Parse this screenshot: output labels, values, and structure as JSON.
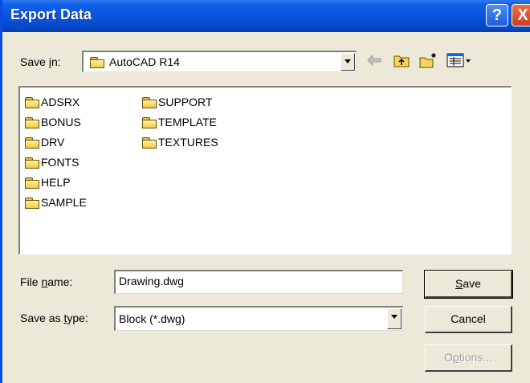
{
  "window": {
    "title": "Export Data"
  },
  "titlebar": {
    "help_label": "?",
    "close_label": "X"
  },
  "save_in": {
    "label_prefix": "Save ",
    "label_u": "i",
    "label_suffix": "n:",
    "value": "AutoCAD R14"
  },
  "toolbar": {
    "back_icon": "back-arrow-icon",
    "up_icon": "up-folder-icon",
    "new_folder_icon": "new-folder-icon",
    "views_icon": "views-menu-icon"
  },
  "files": [
    {
      "name": "ADSRX"
    },
    {
      "name": "BONUS"
    },
    {
      "name": "DRV"
    },
    {
      "name": "FONTS"
    },
    {
      "name": "HELP"
    },
    {
      "name": "SAMPLE"
    },
    {
      "name": "SUPPORT"
    },
    {
      "name": "TEMPLATE"
    },
    {
      "name": "TEXTURES"
    }
  ],
  "file_name": {
    "label_prefix": "File ",
    "label_u": "n",
    "label_suffix": "ame:",
    "value": "Drawing.dwg"
  },
  "save_type": {
    "label_prefix": "Save as ",
    "label_u": "t",
    "label_suffix": "ype:",
    "value": "Block (*.dwg)"
  },
  "buttons": {
    "save_u": "S",
    "save_rest": "ave",
    "cancel": "Cancel",
    "options_prefix": "O",
    "options_u": "p",
    "options_suffix": "tions..."
  }
}
